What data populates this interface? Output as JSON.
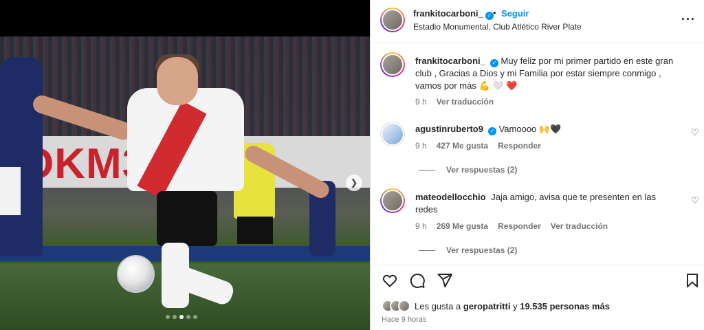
{
  "post": {
    "username": "frankitocarboni_",
    "separator": "•",
    "follow_label": "Seguir",
    "location": "Estadio Monumental, Club Atlético River Plate",
    "more_icon": "more-horizontal-icon",
    "banner_text": "OKM3O"
  },
  "caption": {
    "username": "frankitocarboni_",
    "text": "Muy feliz por mi primer partido en este gran club , Gracias a Dios y mi Familia por estar siempre conmigo , vamos por más 💪 🤍 ❤️",
    "time": "9 h",
    "translate": "Ver traducción"
  },
  "comments": [
    {
      "username": "agustinruberto9",
      "text": "Vamoooo 🙌🖤",
      "time": "9 h",
      "likes": "427 Me gusta",
      "reply": "Responder",
      "replies": "Ver respuestas (2)"
    },
    {
      "username": "mateodellocchio",
      "text": "Jaja amigo, avisa que te presenten en las redes",
      "time": "9 h",
      "likes": "269 Me gusta",
      "reply": "Responder",
      "translate": "Ver traducción",
      "replies": "Ver respuestas (2)"
    }
  ],
  "likes": {
    "prefix": "Les gusta a",
    "user": "geropatritti",
    "middle": "y",
    "count": "19.535 personas más"
  },
  "posted": "Hace 9 horas",
  "carousel": {
    "total": 5,
    "active": 2
  }
}
